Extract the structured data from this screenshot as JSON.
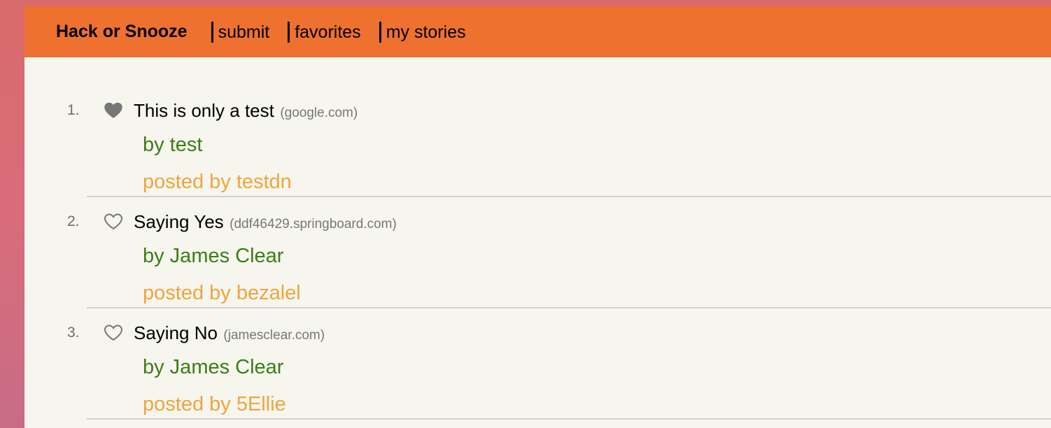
{
  "nav": {
    "brand": "Hack or Snooze",
    "links": [
      "submit",
      "favorites",
      "my stories"
    ]
  },
  "stories": [
    {
      "num": "1.",
      "favorited": true,
      "title": "This is only a test",
      "host": "(google.com)",
      "author": "by test",
      "user": "posted by testdn"
    },
    {
      "num": "2.",
      "favorited": false,
      "title": "Saying Yes",
      "host": "(ddf46429.springboard.com)",
      "author": "by James Clear",
      "user": "posted by bezalel"
    },
    {
      "num": "3.",
      "favorited": false,
      "title": "Saying No",
      "host": "(jamesclear.com)",
      "author": "by James Clear",
      "user": "posted by 5Ellie"
    }
  ],
  "colors": {
    "navbar": "#ee7130",
    "author": "#3b7d15",
    "posted_by": "#f0a43b",
    "star": "#777777"
  },
  "icons": {
    "favorited": "heart-filled-icon",
    "not_favorited": "heart-outline-icon"
  }
}
